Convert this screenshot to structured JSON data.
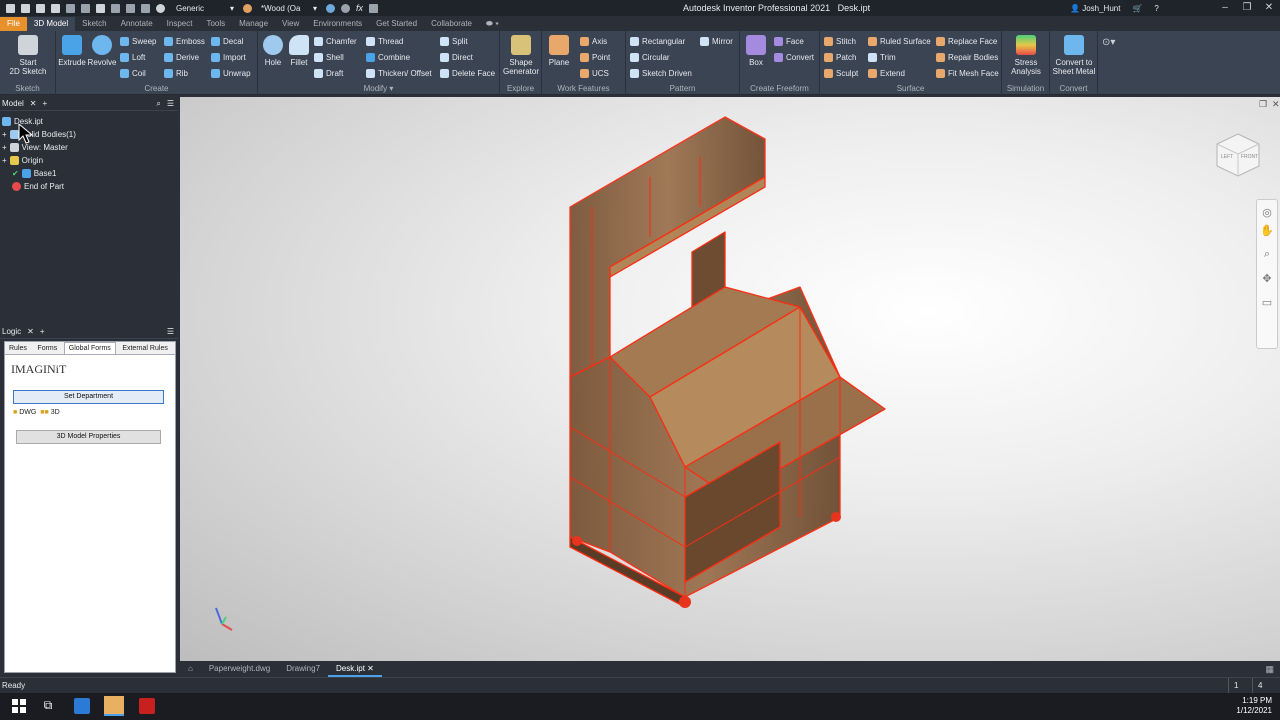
{
  "titlebar": {
    "material": "Generic",
    "appearance": "*Wood (Oa",
    "fx": "fx",
    "app_title": "Autodesk Inventor Professional 2021",
    "doc_title": "Desk.ipt",
    "user": "Josh_Hunt"
  },
  "tabs": [
    "File",
    "3D Model",
    "Sketch",
    "Annotate",
    "Inspect",
    "Tools",
    "Manage",
    "View",
    "Environments",
    "Get Started",
    "Collaborate"
  ],
  "ribbon": {
    "sketch": {
      "label": "Sketch",
      "start": "Start",
      "start2": "2D Sketch"
    },
    "create": {
      "label": "Create",
      "extrude": "Extrude",
      "revolve": "Revolve",
      "sweep": "Sweep",
      "loft": "Loft",
      "coil": "Coil",
      "emboss": "Emboss",
      "derive": "Derive",
      "rib": "Rib",
      "decal": "Decal",
      "import": "Import",
      "unwrap": "Unwrap"
    },
    "modify": {
      "label": "Modify",
      "hole": "Hole",
      "fillet": "Fillet",
      "chamfer": "Chamfer",
      "shell": "Shell",
      "draft": "Draft",
      "thread": "Thread",
      "combine": "Combine",
      "thicken": "Thicken/ Offset",
      "split": "Split",
      "direct": "Direct",
      "delete_face": "Delete Face"
    },
    "explore": {
      "label": "Explore",
      "shape_gen": "Shape",
      "shape_gen2": "Generator"
    },
    "work": {
      "label": "Work Features",
      "plane": "Plane",
      "axis": "Axis",
      "point": "Point",
      "ucs": "UCS"
    },
    "pattern": {
      "label": "Pattern",
      "rectangular": "Rectangular",
      "circular": "Circular",
      "sketch_driven": "Sketch Driven",
      "mirror": "Mirror"
    },
    "freeform": {
      "label": "Create Freeform",
      "box": "Box",
      "face": "Face",
      "convert": "Convert"
    },
    "surface": {
      "label": "Surface",
      "stitch": "Stitch",
      "patch": "Patch",
      "sculpt": "Sculpt",
      "ruled": "Ruled Surface",
      "trim": "Trim",
      "extend": "Extend",
      "replace": "Replace Face",
      "repair": "Repair Bodies",
      "fitmesh": "Fit Mesh Face"
    },
    "simulation": {
      "label": "Simulation",
      "stress": "Stress",
      "stress2": "Analysis"
    },
    "convert": {
      "label": "Convert",
      "sheet": "Convert to",
      "sheet2": "Sheet Metal"
    }
  },
  "model_panel": {
    "title": "Model",
    "items": [
      "Desk.ipt",
      "Solid Bodies(1)",
      "View: Master",
      "Origin",
      "Base1",
      "End of Part"
    ]
  },
  "logic_panel": {
    "title": "Logic",
    "tabs": [
      "Rules",
      "Forms",
      "Global Forms",
      "External Rules"
    ],
    "logo": "IMAGINiT",
    "set_dept": "Set Department",
    "dwg": "DWG",
    "three_d": "3D",
    "props": "3D Model Properties"
  },
  "doc_tabs": [
    "Paperweight.dwg",
    "Drawing7",
    "Desk.ipt"
  ],
  "status": {
    "text": "Ready",
    "n1": "1",
    "n2": "4"
  },
  "viewcube": {
    "left": "LEFT",
    "front": "FRONT"
  },
  "taskbar": {
    "time": "1:19 PM",
    "date": "1/12/2021"
  },
  "colors": {
    "accent": "#e8912c",
    "ribbon": "#3b4453",
    "highlight": "#ff2a10",
    "wood": "#8a6443"
  }
}
